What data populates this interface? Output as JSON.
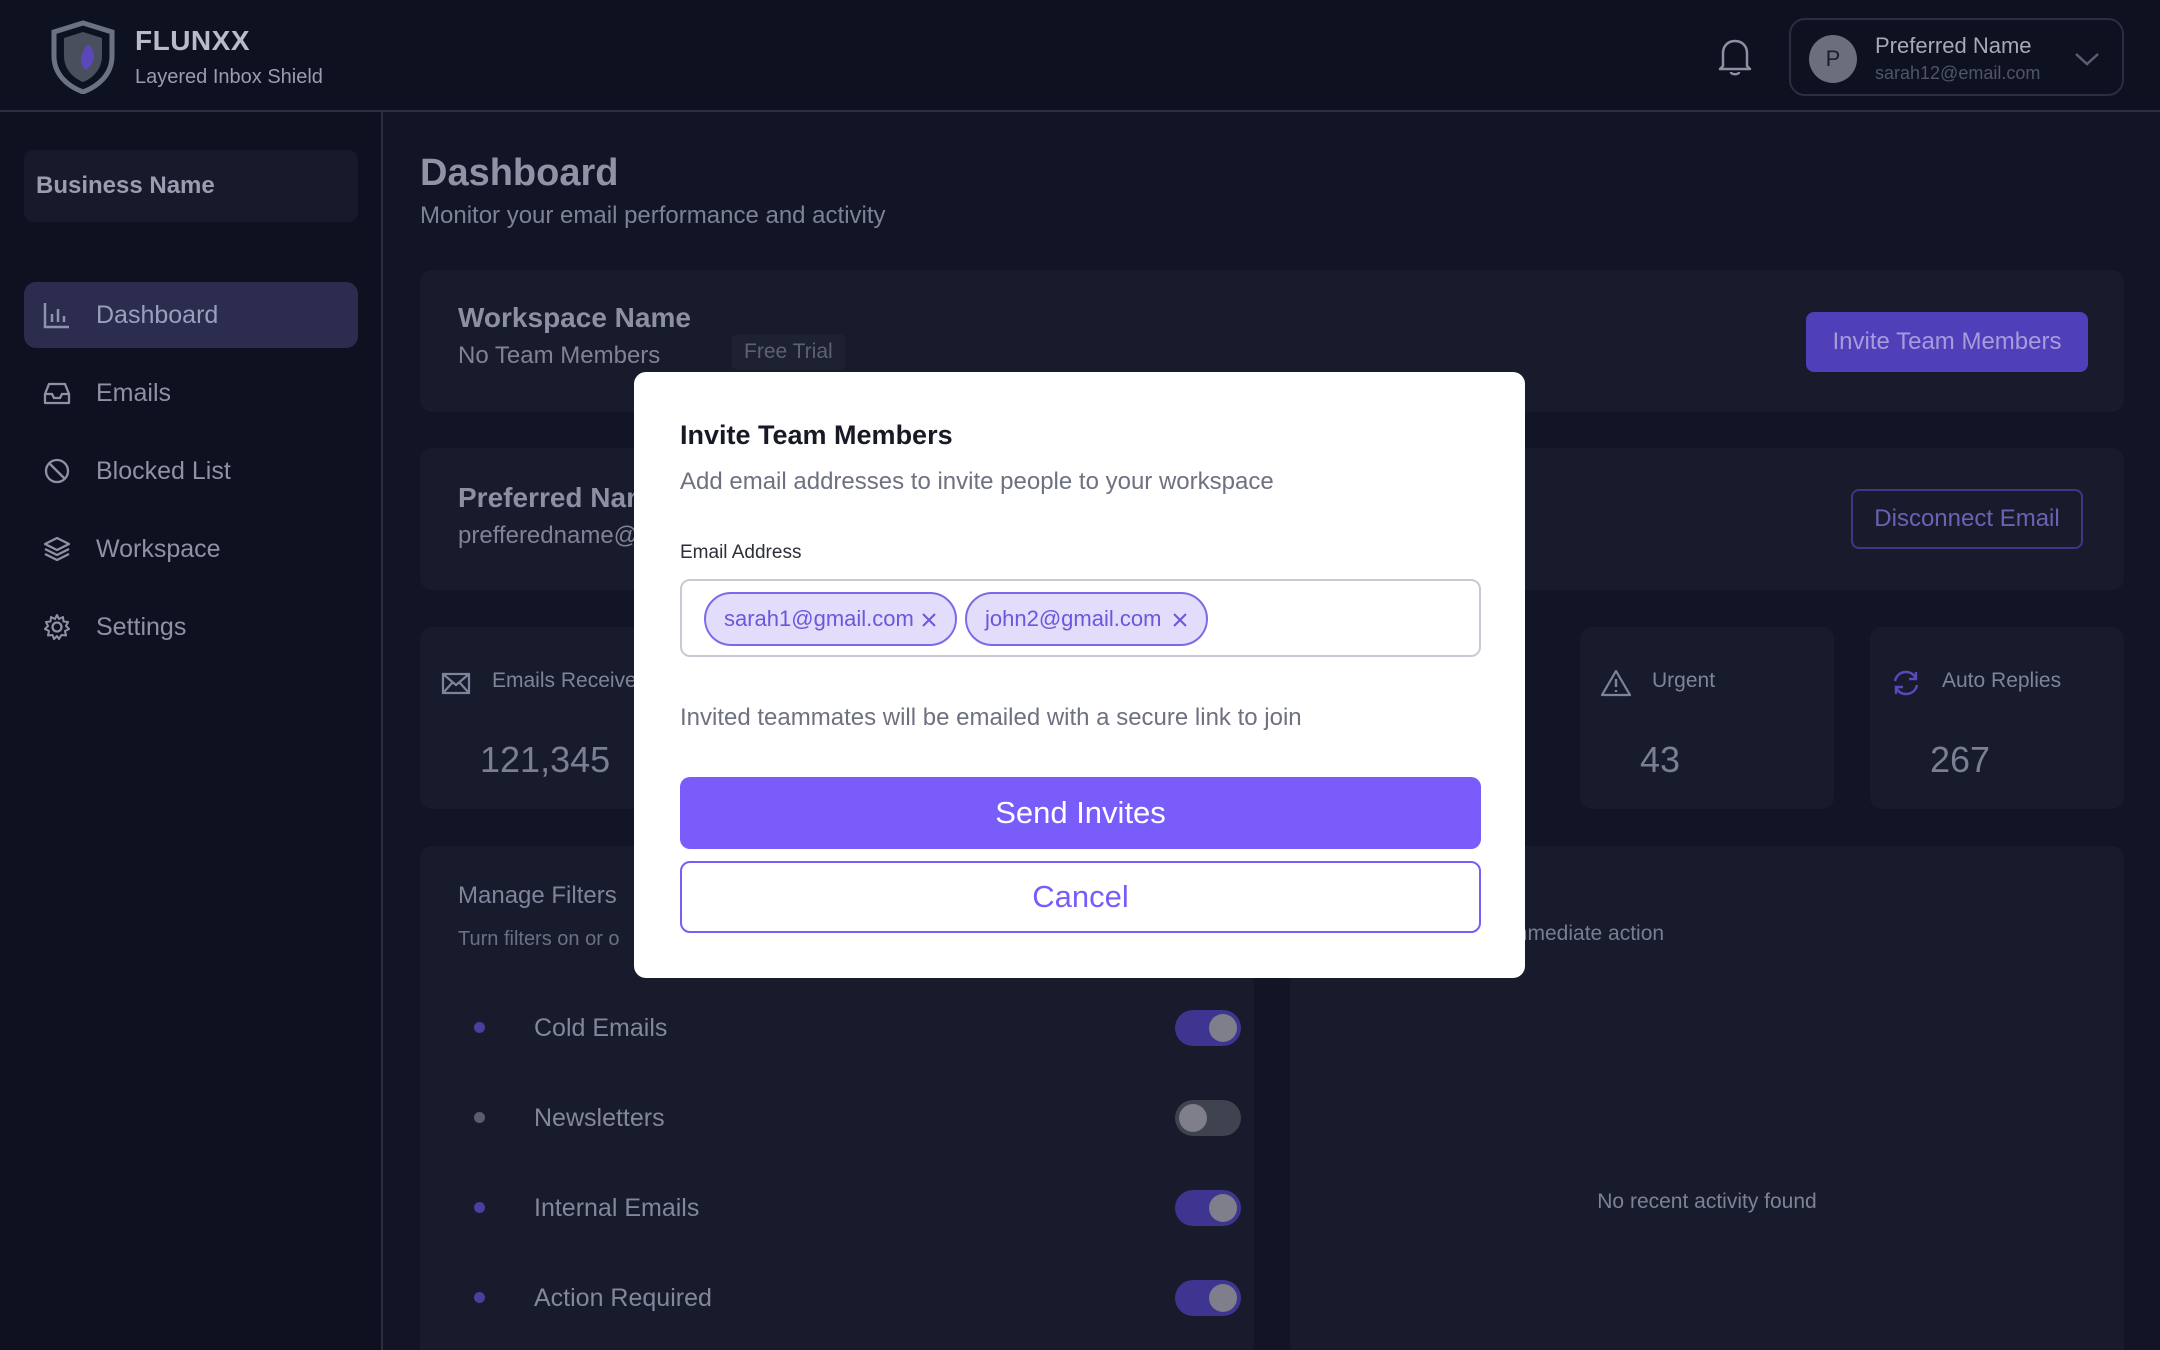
{
  "app": {
    "brand_name": "FLUNXX",
    "tagline": "Layered Inbox Shield"
  },
  "header": {
    "user_initial": "P",
    "user_name": "Preferred Name",
    "user_email": "sarah12@email.com",
    "icons": [
      "shield-logo-icon",
      "bell-icon",
      "chevron-down-icon"
    ]
  },
  "sidebar": {
    "business_name": "Business Name",
    "items": [
      {
        "label": "Dashboard",
        "icon": "bar-chart-icon",
        "active": true
      },
      {
        "label": "Emails",
        "icon": "inbox-icon",
        "active": false
      },
      {
        "label": "Blocked List",
        "icon": "ban-icon",
        "active": false
      },
      {
        "label": "Workspace",
        "icon": "layers-icon",
        "active": false
      },
      {
        "label": "Settings",
        "icon": "gear-icon",
        "active": false
      }
    ]
  },
  "page": {
    "title": "Dashboard",
    "subtitle": "Monitor your email performance and activity"
  },
  "workspace_card": {
    "name": "Workspace Name",
    "members": "No Team Members",
    "badge": "Free Trial",
    "invite_button": "Invite Team Members"
  },
  "account_card": {
    "name": "Preferred Name",
    "email": "prefferedname@",
    "disconnect_button": "Disconnect Email"
  },
  "stats": [
    {
      "label": "Emails Received",
      "value": "121,345",
      "icon": "envelope-icon"
    },
    {
      "label": "Urgent",
      "value": "43",
      "icon": "warning-icon"
    },
    {
      "label": "Auto Replies",
      "value": "267",
      "icon": "refresh-icon"
    }
  ],
  "filters": {
    "title": "Manage Filters",
    "subtitle": "Turn filters on or o",
    "items": [
      {
        "label": "Cold Emails",
        "enabled": true
      },
      {
        "label": "Newsletters",
        "enabled": false
      },
      {
        "label": "Internal Emails",
        "enabled": true
      },
      {
        "label": "Action Required",
        "enabled": true
      }
    ]
  },
  "activity": {
    "hint": "mmediate action",
    "empty": "No recent activity found"
  },
  "modal": {
    "title": "Invite Team Members",
    "subtitle": "Add email addresses to invite people to your workspace",
    "field_label": "Email Address",
    "tags": [
      "sarah1@gmail.com",
      "john2@gmail.com"
    ],
    "hint": "Invited teammates will be emailed with a secure link to join",
    "send_button": "Send Invites",
    "cancel_button": "Cancel"
  },
  "colors": {
    "accent": "#7a5cfa",
    "background": "#111526",
    "surface": "#171b2c",
    "overlay_modal": "#ffffff"
  }
}
